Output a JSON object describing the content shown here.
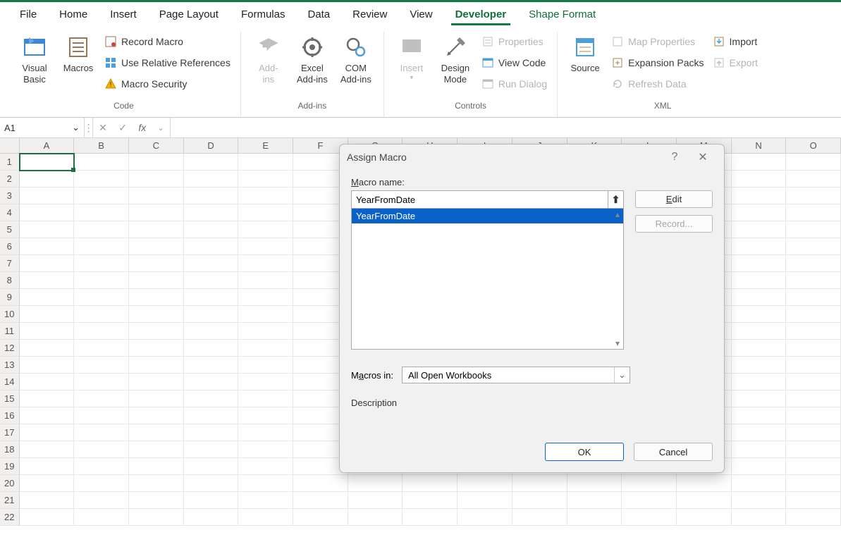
{
  "tabs": {
    "file": "File",
    "home": "Home",
    "insert": "Insert",
    "pagelayout": "Page Layout",
    "formulas": "Formulas",
    "data": "Data",
    "review": "Review",
    "view": "View",
    "developer": "Developer",
    "shapefmt": "Shape Format"
  },
  "ribbon": {
    "code": {
      "visualbasic": "Visual\nBasic",
      "macros": "Macros",
      "record": "Record Macro",
      "relative": "Use Relative References",
      "security": "Macro Security",
      "label": "Code"
    },
    "addins": {
      "addins": "Add-\nins",
      "excel": "Excel\nAdd-ins",
      "com": "COM\nAdd-ins",
      "label": "Add-ins"
    },
    "controls": {
      "insert": "Insert",
      "design": "Design\nMode",
      "properties": "Properties",
      "viewcode": "View Code",
      "rundialog": "Run Dialog",
      "label": "Controls"
    },
    "xml": {
      "source": "Source",
      "mapprops": "Map Properties",
      "expansion": "Expansion Packs",
      "refresh": "Refresh Data",
      "import": "Import",
      "export": "Export",
      "label": "XML"
    }
  },
  "nameBox": "A1",
  "columns": [
    "A",
    "B",
    "C",
    "D",
    "E",
    "F",
    "G",
    "H",
    "I",
    "J",
    "K",
    "L",
    "M",
    "N",
    "O"
  ],
  "rows": [
    "1",
    "2",
    "3",
    "4",
    "5",
    "6",
    "7",
    "8",
    "9",
    "10",
    "11",
    "12",
    "13",
    "14",
    "15",
    "16",
    "17",
    "18",
    "19",
    "20",
    "21",
    "22"
  ],
  "dialog": {
    "title": "Assign Macro",
    "macroNameLabel": "Macro name:",
    "macroName": "YearFromDate",
    "listItem": "YearFromDate",
    "edit": "Edit",
    "record": "Record...",
    "macrosInLabel": "Macros in:",
    "macrosInValue": "All Open Workbooks",
    "description": "Description",
    "ok": "OK",
    "cancel": "Cancel"
  }
}
